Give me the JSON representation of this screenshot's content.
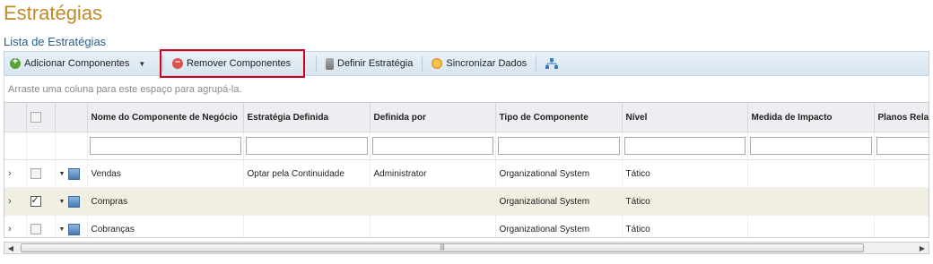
{
  "page": {
    "title": "Estratégias",
    "subtitle": "Lista de Estratégias"
  },
  "toolbar": {
    "add_label": "Adicionar Componentes",
    "remove_label": "Remover Componentes",
    "define_label": "Definir Estratégia",
    "sync_label": "Sincronizar Dados"
  },
  "group_hint": "Arraste uma coluna para este espaço para agrupá-la.",
  "table": {
    "columns": [
      "Nome do Componente de Negócio",
      "Estratégia Definida",
      "Definida por",
      "Tipo de Componente",
      "Nível",
      "Medida de Impacto",
      "Planos Relac"
    ],
    "rows": [
      {
        "name": "Vendas",
        "strategy": "Optar pela Continuidade",
        "by": "Administrator",
        "type": "Organizational System",
        "level": "Tático",
        "impact": "",
        "plans": "",
        "checked": false
      },
      {
        "name": "Compras",
        "strategy": "",
        "by": "",
        "type": "Organizational System",
        "level": "Tático",
        "impact": "",
        "plans": "",
        "checked": true
      },
      {
        "name": "Cobranças",
        "strategy": "",
        "by": "",
        "type": "Organizational System",
        "level": "Tático",
        "impact": "",
        "plans": "",
        "checked": false
      }
    ]
  },
  "colors": {
    "title": "#c0892a",
    "subtitle": "#2a5d8f",
    "highlight": "#d0021b",
    "selected_row": "#f0efe2"
  }
}
